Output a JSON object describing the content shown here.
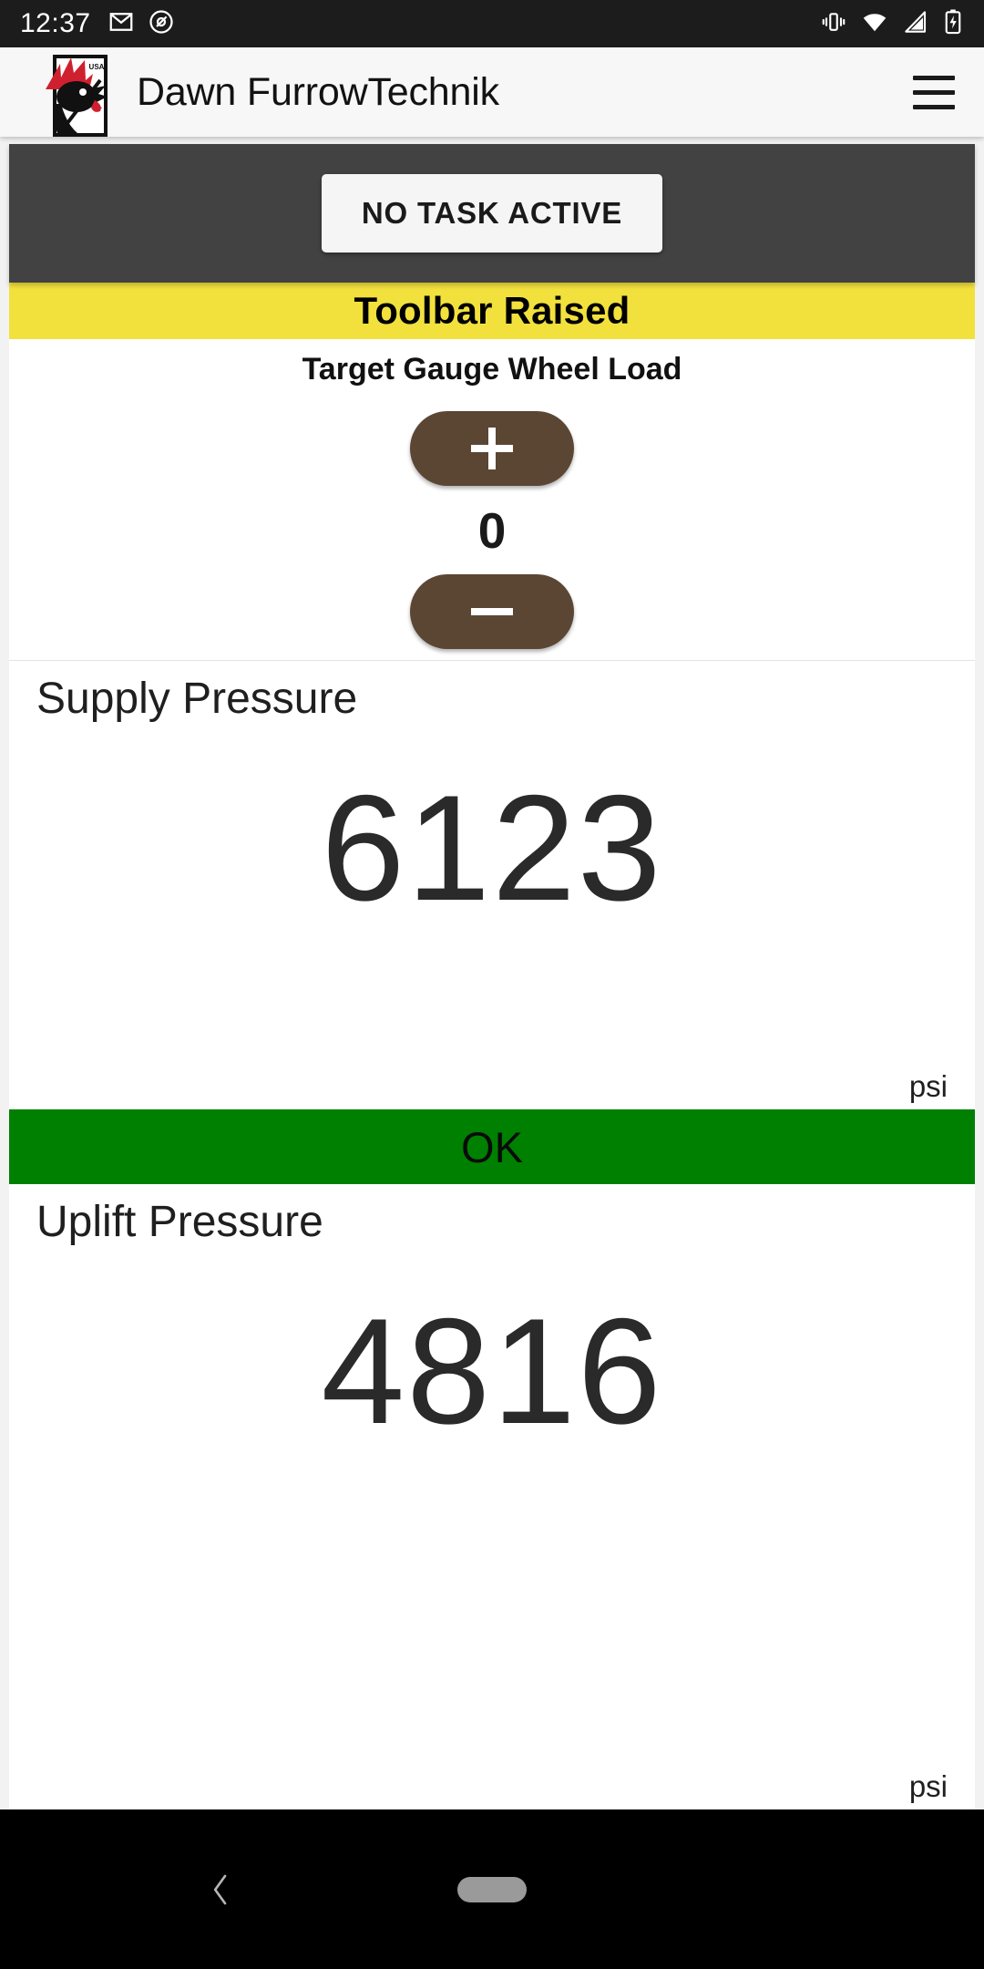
{
  "statusbar": {
    "time": "12:37",
    "left_icons": [
      "gmail-icon",
      "assistant-icon"
    ],
    "right_icons": [
      "vibrate-icon",
      "wifi-icon",
      "cell-signal-icon",
      "battery-charging-icon"
    ]
  },
  "appbar": {
    "logo_name": "dawn-equipment-rooster-logo",
    "title": "Dawn FurrowTechnik",
    "menu_label": "menu-icon"
  },
  "task_panel": {
    "button_label": "NO TASK ACTIVE"
  },
  "toolbar_status": {
    "text": "Toolbar Raised",
    "color": "#f2e13d"
  },
  "stepper": {
    "title": "Target Gauge Wheel Load",
    "increment_label": "+",
    "value": "0",
    "decrement_label": "—",
    "button_color": "#5b4634"
  },
  "gauges": [
    {
      "label": "Supply Pressure",
      "value": "6123",
      "unit": "psi",
      "status": "OK",
      "status_color": "#008000"
    },
    {
      "label": "Uplift Pressure",
      "value": "4816",
      "unit": "psi"
    }
  ],
  "navbar": {
    "back_label": "back-icon",
    "home_label": "home-pill"
  }
}
